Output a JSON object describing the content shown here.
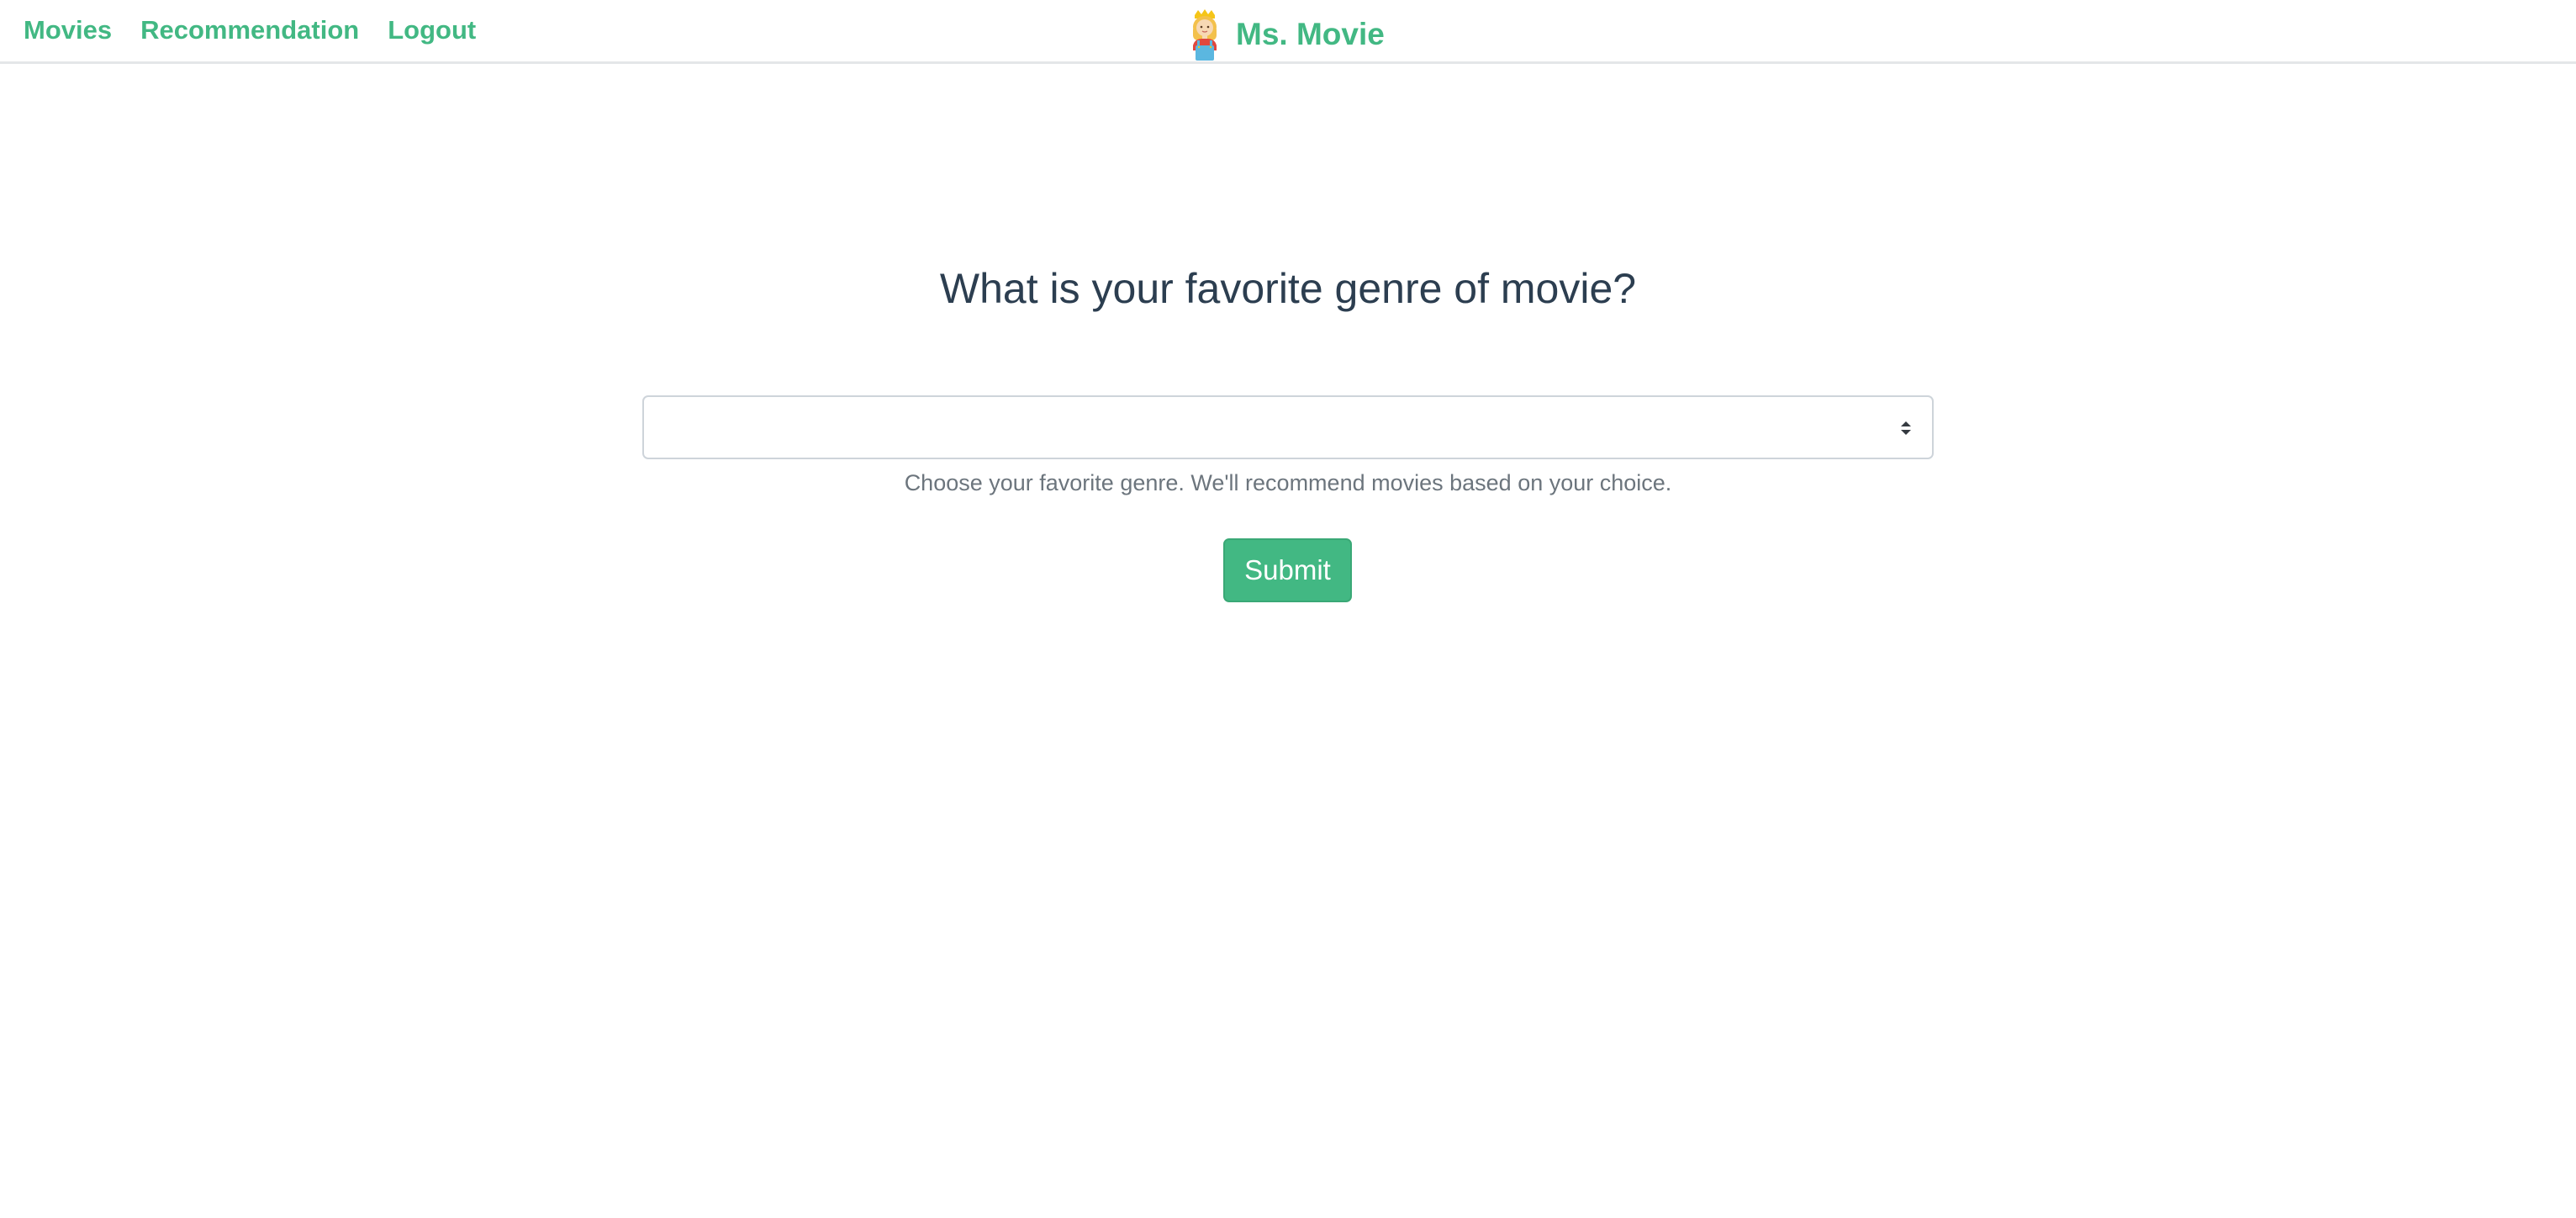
{
  "nav": {
    "links": [
      {
        "label": "Movies"
      },
      {
        "label": "Recommendation"
      },
      {
        "label": "Logout"
      }
    ],
    "brand": {
      "name": "Ms. Movie",
      "logo_icon": "woman-avatar-icon"
    }
  },
  "main": {
    "title": "What is your favorite genre of movie?",
    "genre_select": {
      "selected_value": ""
    },
    "help_text": "Choose your favorite genre. We'll recommend movies based on your choice.",
    "submit_label": "Submit"
  },
  "colors": {
    "accent": "#42b883",
    "heading": "#2c3e50",
    "muted": "#6c757d",
    "border": "#ced4da"
  }
}
